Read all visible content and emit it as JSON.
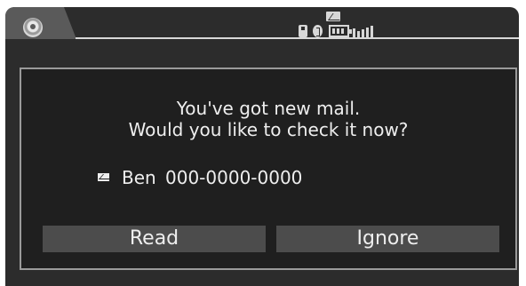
{
  "status_bar": {
    "icons": [
      "home-icon",
      "mail-status-icon",
      "usb-icon",
      "bluetooth-icon",
      "battery-icon",
      "signal-icon"
    ]
  },
  "dialog": {
    "message_line_1": "You've got new mail.",
    "message_line_2": "Would you like to check it now?",
    "sender_name": "Ben",
    "sender_number": "000-0000-0000",
    "read_button": "Read",
    "ignore_button": "Ignore"
  },
  "colors": {
    "screen_background": "#2c2c2c",
    "dialog_background": "#1f1f1f",
    "button_background": "#4c4c4c",
    "text": "#eeeeee",
    "border": "#9a9a9a"
  }
}
